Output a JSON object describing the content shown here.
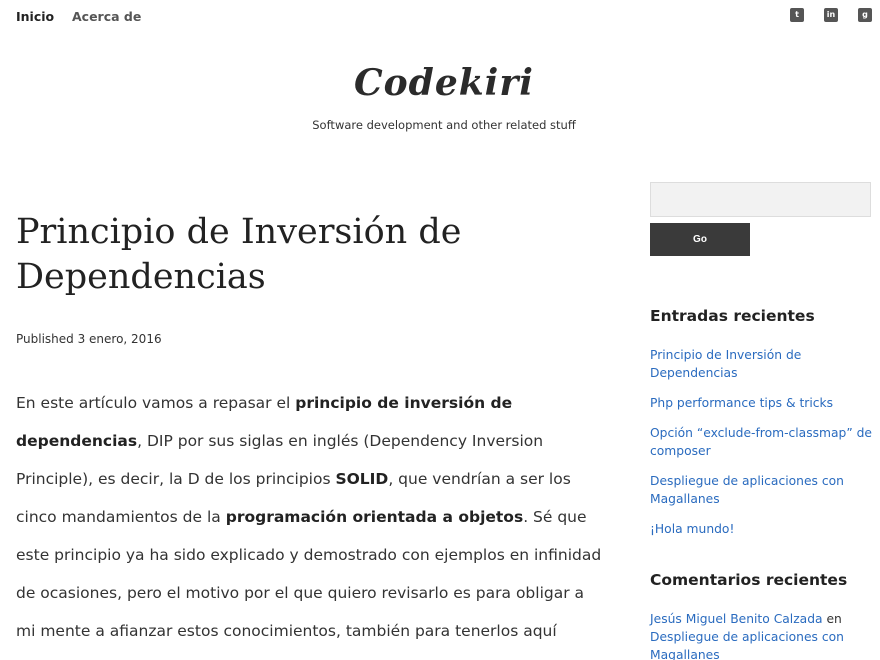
{
  "nav": {
    "links": [
      "Inicio",
      "Acerca de"
    ],
    "social": {
      "twitter": "twitter-icon",
      "linkedin": "linkedin-icon",
      "github": "github-icon"
    }
  },
  "header": {
    "title": "Codekiri",
    "tagline": "Software development and other related stuff"
  },
  "post": {
    "title": "Principio de Inversión de Dependencias",
    "published": "Published 3 enero, 2016",
    "p1_a": "En este artículo vamos a repasar el ",
    "p1_b": "principio de inversión de dependencias",
    "p1_c": ", DIP por sus siglas en inglés (Dependency Inversion Principle), es decir, la D de los principios ",
    "p1_d": "SOLID",
    "p1_e": ", que vendrían a ser los cinco mandamientos de la ",
    "p1_f": "programación orientada a objetos",
    "p1_g": ". Sé que este principio ya ha sido explicado y demostrado con ejemplos en infinidad de ocasiones, pero el motivo por el que quiero revisarlo es para obligar a mi mente a afianzar estos conocimientos, también para tenerlos aquí plasmados por si algún día"
  },
  "sidebar": {
    "search_placeholder": "",
    "go_label": "Go",
    "recent_posts_title": "Entradas recientes",
    "recent_posts": [
      "Principio de Inversión de Dependencias",
      "Php performance tips & tricks",
      "Opción “exclude-from-classmap” de composer",
      "Despliegue de aplicaciones con Magallanes",
      "¡Hola mundo!"
    ],
    "recent_comments_title": "Comentarios recientes",
    "comment_author": "Jesús Miguel Benito Calzada",
    "comment_on": " en ",
    "comment_post": "Despliegue de aplicaciones con Magallanes"
  },
  "colors": {
    "link": "#2a6bbf",
    "button": "#3a3a3a"
  }
}
